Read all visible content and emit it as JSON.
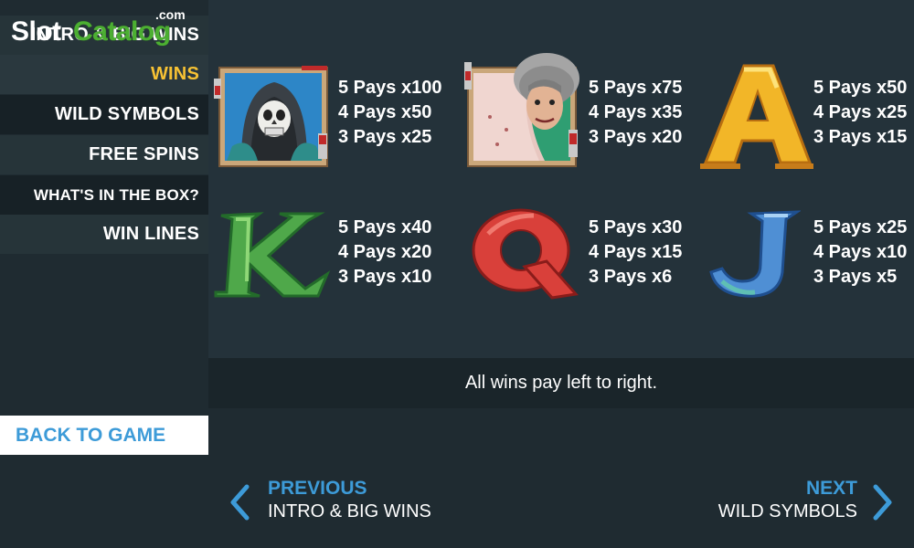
{
  "watermark": {
    "brand": "SlotCatalog",
    "slot": "Slot",
    "catalog": "Catalog",
    "dotcom": ".com"
  },
  "sidebar": {
    "items": [
      {
        "label": "INTRO & BIG WINS"
      },
      {
        "label": "WINS"
      },
      {
        "label": "WILD SYMBOLS"
      },
      {
        "label": "FREE SPINS"
      },
      {
        "label": "WHAT'S IN THE BOX?"
      },
      {
        "label": "WIN LINES"
      }
    ],
    "active_item": "WINS",
    "back_label": "BACK TO GAME"
  },
  "paytable": {
    "symbols": [
      {
        "name": "reaper",
        "pays": [
          "5 Pays x100",
          "4 Pays x50",
          "3 Pays x25"
        ]
      },
      {
        "name": "woman-with-shower-curtain",
        "pays": [
          "5 Pays x75",
          "4 Pays x35",
          "3 Pays x20"
        ]
      },
      {
        "name": "A",
        "pays": [
          "5 Pays x50",
          "4 Pays x25",
          "3 Pays x15"
        ]
      },
      {
        "name": "K",
        "pays": [
          "5 Pays x40",
          "4 Pays x20",
          "3 Pays x10"
        ]
      },
      {
        "name": "Q",
        "pays": [
          "5 Pays x30",
          "4 Pays x15",
          "3 Pays x6"
        ]
      },
      {
        "name": "J",
        "pays": [
          "5 Pays x25",
          "4 Pays x10",
          "3 Pays x5"
        ]
      }
    ],
    "note": "All wins pay left to right."
  },
  "navigation": {
    "prev": {
      "title": "PREVIOUS",
      "subtitle": "INTRO & BIG WINS"
    },
    "next": {
      "title": "NEXT",
      "subtitle": "WILD SYMBOLS"
    }
  },
  "colors": {
    "accent_blue": "#3d9bd8",
    "active_gold": "#f7c234",
    "background": "#1f2b31"
  }
}
